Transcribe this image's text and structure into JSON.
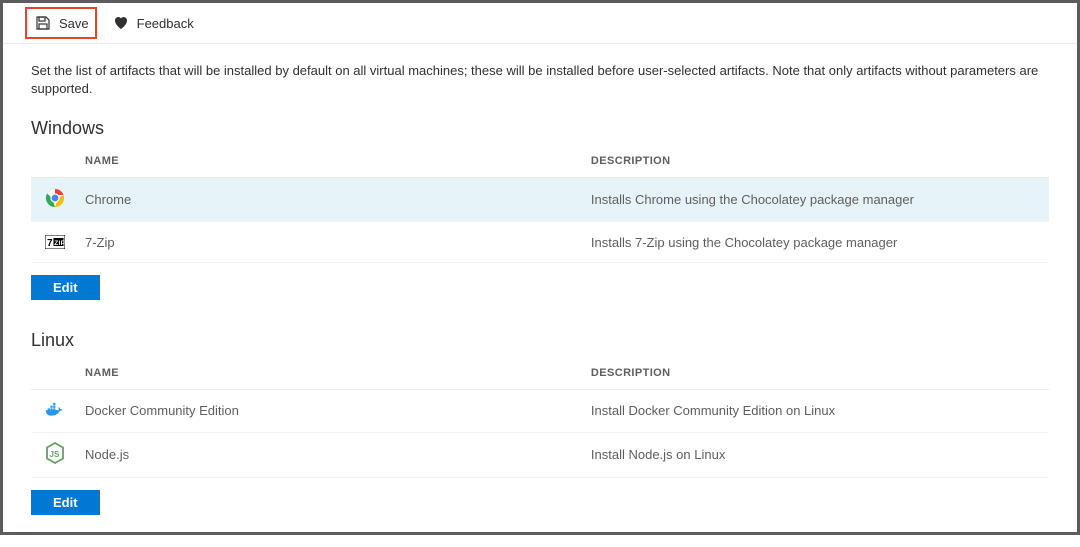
{
  "toolbar": {
    "save_label": "Save",
    "feedback_label": "Feedback"
  },
  "intro": "Set the list of artifacts that will be installed by default on all virtual machines; these will be installed before user-selected artifacts. Note that only artifacts without parameters are supported.",
  "columns": {
    "name": "NAME",
    "description": "DESCRIPTION"
  },
  "sections": {
    "windows": {
      "title": "Windows",
      "rows": [
        {
          "name": "Chrome",
          "description": "Installs Chrome using the Chocolatey package manager",
          "selected": true
        },
        {
          "name": "7-Zip",
          "description": "Installs 7-Zip using the Chocolatey package manager",
          "selected": false
        }
      ],
      "edit_label": "Edit"
    },
    "linux": {
      "title": "Linux",
      "rows": [
        {
          "name": "Docker Community Edition",
          "description": "Install Docker Community Edition on Linux",
          "selected": false
        },
        {
          "name": "Node.js",
          "description": "Install Node.js on Linux",
          "selected": false
        }
      ],
      "edit_label": "Edit"
    }
  }
}
